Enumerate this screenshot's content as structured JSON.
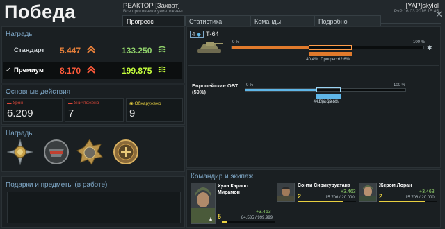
{
  "header": {
    "title": "Победа",
    "battle_mode": "РЕАКТОР [Захват]",
    "battle_sub": "Все противники уничтожены",
    "player_name": "[YAP]skylol",
    "player_sub": "PvP 16.03.2016 15:45"
  },
  "tabs": [
    {
      "label": "Прогресс",
      "active": true
    },
    {
      "label": "Статистика",
      "active": false
    },
    {
      "label": "Команды",
      "active": false
    },
    {
      "label": "Подробно",
      "active": false
    }
  ],
  "rewards": {
    "title": "Награды",
    "standard": {
      "label": "Стандарт",
      "credits": "5.447",
      "xp": "133.250"
    },
    "premium": {
      "label": "Премиум",
      "check": "✓",
      "credits": "8.170",
      "xp": "199.875"
    }
  },
  "actions": {
    "title": "Основные действия",
    "damage": {
      "label": "Урон",
      "value": "6.209"
    },
    "killed": {
      "label": "Уничтожено",
      "value": "7"
    },
    "spotted": {
      "label": "Обнаружено",
      "value": "9"
    }
  },
  "medals": {
    "title": "Награды",
    "items": [
      "medal-1-icon",
      "medal-2-icon",
      "medal-3-icon",
      "medal-4-icon"
    ]
  },
  "gifts": {
    "title": "Подарки и предметы (в работе)"
  },
  "tank": {
    "tier": "4",
    "name": "Т-64",
    "bar_start": "0 %",
    "bar_end": "100 %",
    "progress_left": "40,4%",
    "progress_label": "Прогресс",
    "progress_right": "62,6%",
    "progress_from": 0.404,
    "progress_to": 0.626
  },
  "class": {
    "name": "Европейские ОБТ",
    "pct": "(59%)",
    "bar_start": "0 %",
    "bar_end": "100 %",
    "progress_left": "44,3%",
    "progress_label": "Прогресс",
    "progress_right": "59,6%",
    "progress_from": 0.443,
    "progress_to": 0.596
  },
  "crew": {
    "title": "Командир и экипаж",
    "commander": {
      "name_line1": "Хуан Карлос",
      "name_line2": "Мирамон",
      "level": "5",
      "xp_gain": "+3.463",
      "xp_progress": "84.535 / 999.999",
      "xp_fraction": 0.085
    },
    "members": [
      {
        "name": "Сонти Сирикуруатана",
        "level": "2",
        "xp_gain": "+3.463",
        "xp_progress": "15.706 / 20.000",
        "xp_fraction": 0.785
      },
      {
        "name": "Жером Лоран",
        "level": "2",
        "xp_gain": "+3.463",
        "xp_progress": "15.706 / 20.000",
        "xp_fraction": 0.785
      }
    ]
  },
  "colors": {
    "credits": "#e8803a",
    "xp": "#8fd06a",
    "tank_bar": "#e07a2c",
    "class_bar": "#5fb6e8",
    "accent": "#7fa8c8"
  }
}
